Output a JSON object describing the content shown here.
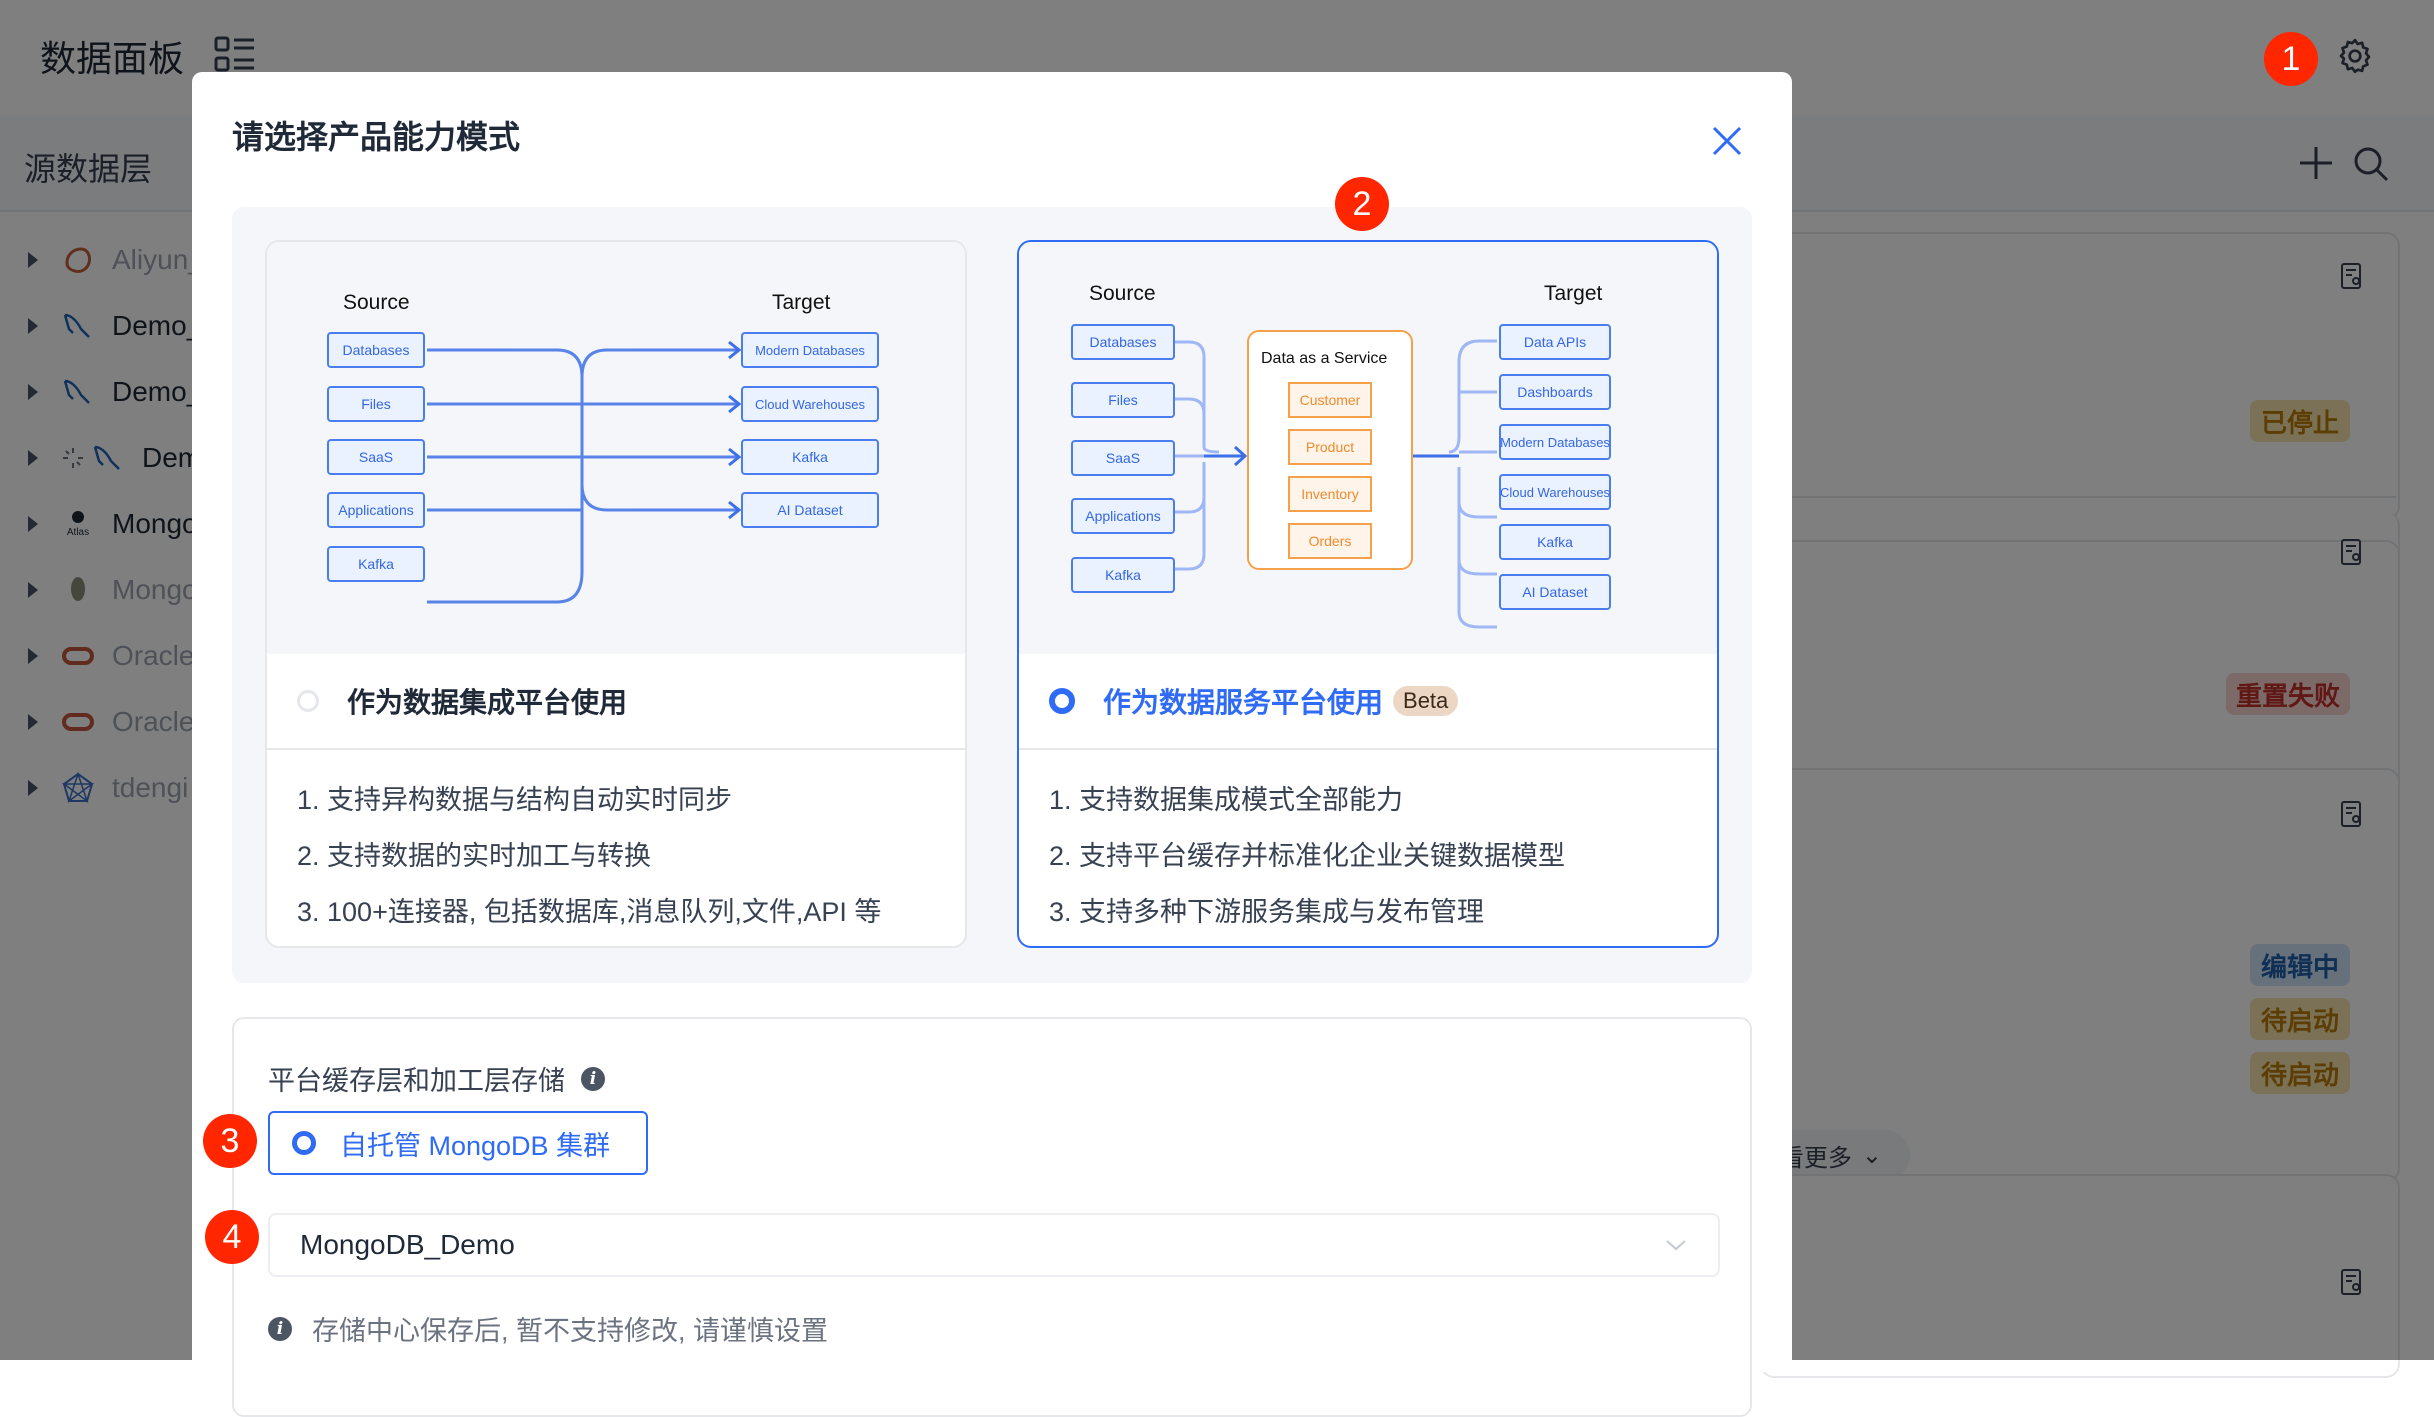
{
  "app": {
    "title": "数据面板",
    "section_title": "源数据层",
    "layout_icon": "layout-list-icon",
    "settings_icon": "gear-icon",
    "add_icon": "plus-icon",
    "search_icon": "search-icon"
  },
  "sidebar": {
    "items": [
      {
        "label": "Aliyun_",
        "icon": "aliyun-mysql-icon",
        "dimmed": true
      },
      {
        "label": "Demo_",
        "icon": "mysql-dolphin-icon",
        "dimmed": false
      },
      {
        "label": "Demo_",
        "icon": "mysql-dolphin-icon",
        "dimmed": false
      },
      {
        "label": "Dem",
        "icon": "loading-mysql-icon",
        "dimmed": false
      },
      {
        "label": "Mongo",
        "icon": "mongodb-atlas-icon",
        "dimmed": false
      },
      {
        "label": "Mongo",
        "icon": "mongodb-leaf-icon",
        "dimmed": true
      },
      {
        "label": "Oracle",
        "icon": "oracle-icon",
        "dimmed": true
      },
      {
        "label": "Oracle",
        "icon": "oracle-icon",
        "dimmed": true
      },
      {
        "label": "tdengi",
        "icon": "tdengine-icon",
        "dimmed": true
      }
    ]
  },
  "right_panel": {
    "statuses": [
      {
        "label": "已停止",
        "color": "#b97d0a",
        "bg": "#f6e3ad"
      },
      {
        "label": "重置失败",
        "color": "#c0302b",
        "bg": "#f9d4d2"
      },
      {
        "label": "编辑中",
        "color": "#1f5fa8",
        "bg": "#cfe3f7"
      },
      {
        "label": "待启动",
        "color": "#b97d0a",
        "bg": "#f6e3ad"
      },
      {
        "label": "待启动",
        "color": "#b97d0a",
        "bg": "#f6e3ad"
      }
    ],
    "more_label": "看更多"
  },
  "annotations": [
    "1",
    "2",
    "3",
    "4"
  ],
  "modal": {
    "title": "请选择产品能力模式",
    "close_icon": "close-icon",
    "options": [
      {
        "label": "作为数据集成平台使用",
        "selected": false,
        "diagram": {
          "source_title": "Source",
          "target_title": "Target",
          "sources": [
            "Databases",
            "Files",
            "SaaS",
            "Applications",
            "Kafka"
          ],
          "targets": [
            "Modern Databases",
            "Cloud Warehouses",
            "Kafka",
            "AI Dataset"
          ]
        },
        "features": [
          "1. 支持异构数据与结构自动实时同步",
          "2. 支持数据的实时加工与转换",
          "3. 100+连接器, 包括数据库,消息队列,文件,API 等"
        ]
      },
      {
        "label": "作为数据服务平台使用",
        "badge": "Beta",
        "selected": true,
        "diagram": {
          "source_title": "Source",
          "target_title": "Target",
          "service_title": "Data as a Service",
          "sources": [
            "Databases",
            "Files",
            "SaaS",
            "Applications",
            "Kafka"
          ],
          "service_models": [
            "Customer",
            "Product",
            "Inventory",
            "Orders"
          ],
          "targets": [
            "Data APIs",
            "Dashboards",
            "Modern Databases",
            "Cloud Warehouses",
            "Kafka",
            "AI Dataset"
          ]
        },
        "features": [
          "1. 支持数据集成模式全部能力",
          "2. 支持平台缓存并标准化企业关键数据模型",
          "3. 支持多种下游服务集成与发布管理"
        ]
      }
    ],
    "storage": {
      "label": "平台缓存层和加工层存储",
      "option_label": "自托管 MongoDB 集群",
      "option_selected": true,
      "select_value": "MongoDB_Demo",
      "hint": "存储中心保存后, 暂不支持修改, 请谨慎设置"
    }
  },
  "colors": {
    "accent": "#2f6bf5",
    "badge_red": "#ff2600",
    "service_orange": "#f5a04a"
  }
}
